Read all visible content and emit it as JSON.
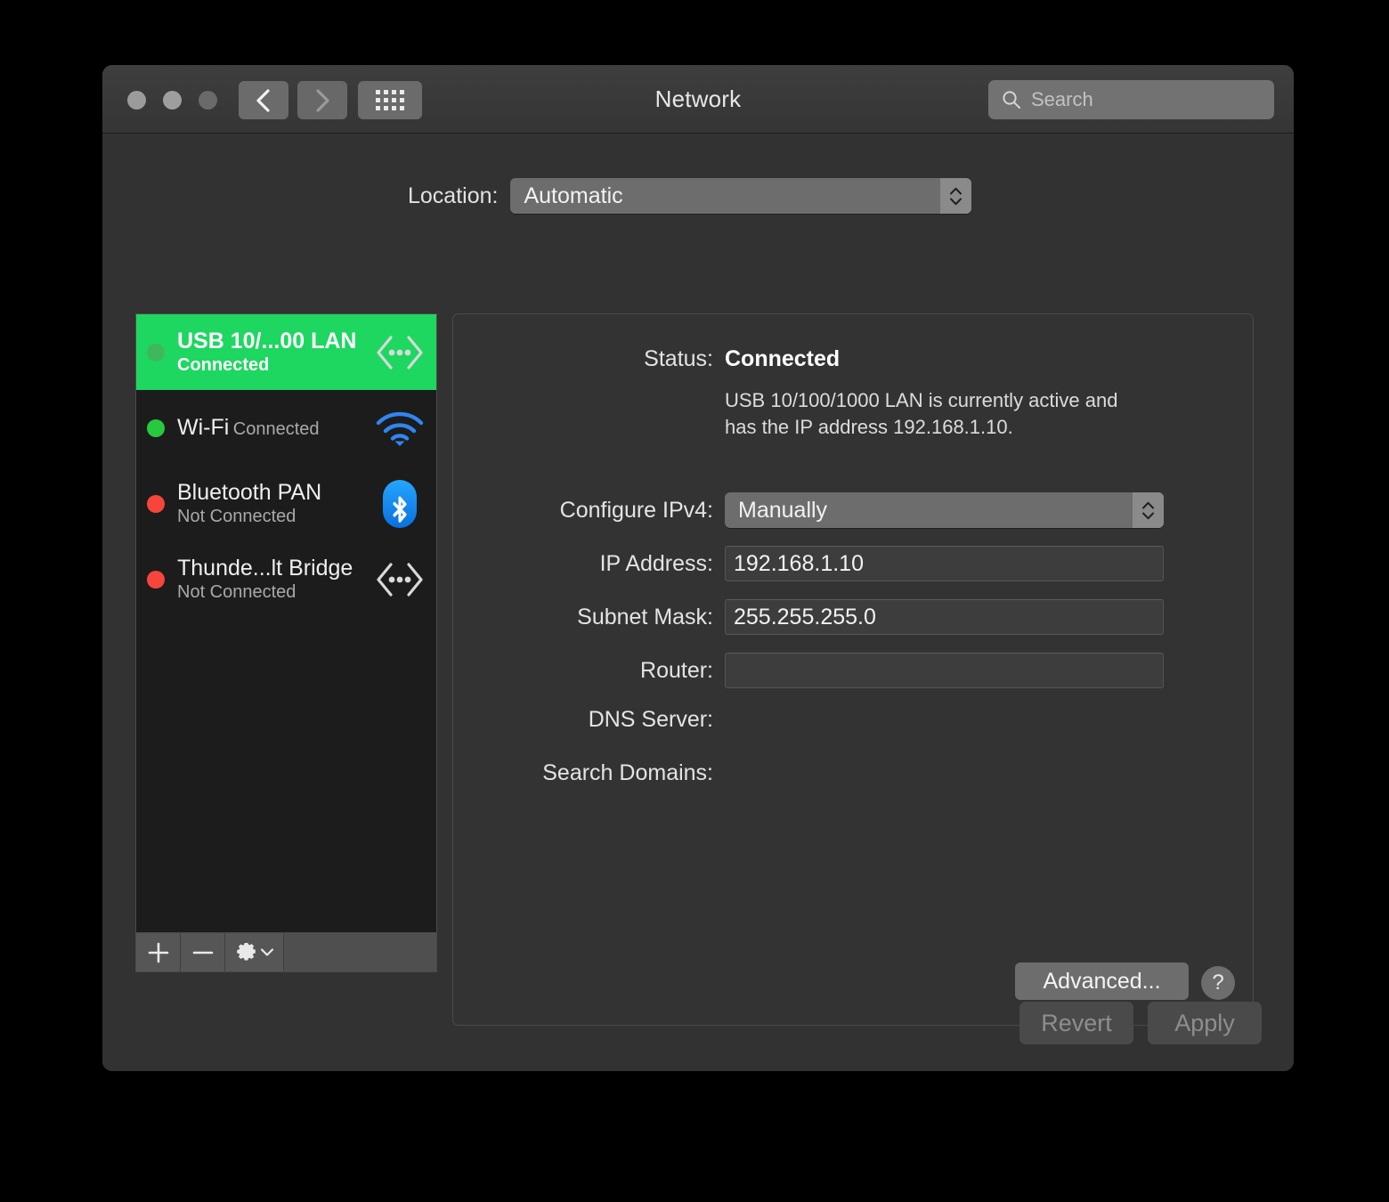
{
  "window": {
    "title": "Network",
    "traffic_lights": [
      "close-button",
      "minimize-button",
      "zoom-button"
    ],
    "nav": {
      "back": "back-button",
      "forward": "forward-button",
      "grid": "show-all-button"
    }
  },
  "search": {
    "placeholder": "Search",
    "value": "",
    "icon": "search-icon"
  },
  "location": {
    "label": "Location:",
    "value": "Automatic"
  },
  "interfaces": [
    {
      "name": "USB 10/...00 LAN",
      "state": "Connected",
      "dot": "green",
      "icon": "ethernet-icon",
      "selected": true
    },
    {
      "name": "Wi-Fi",
      "state": "Connected",
      "dot": "green",
      "icon": "wifi-icon",
      "selected": false
    },
    {
      "name": "Bluetooth PAN",
      "state": "Not Connected",
      "dot": "red",
      "icon": "bluetooth-icon",
      "selected": false
    },
    {
      "name": "Thunde...lt Bridge",
      "state": "Not Connected",
      "dot": "red",
      "icon": "ethernet-icon",
      "selected": false
    }
  ],
  "sidebar_toolbar": {
    "add": "+",
    "remove": "−",
    "gear": "gear-icon"
  },
  "detail": {
    "status_label": "Status:",
    "status_value": "Connected",
    "status_description": "USB 10/100/1000 LAN is currently active and has the IP address 192.168.1.10.",
    "configure_ipv4_label": "Configure IPv4:",
    "configure_ipv4_value": "Manually",
    "ip_address_label": "IP Address:",
    "ip_address_value": "192.168.1.10",
    "subnet_mask_label": "Subnet Mask:",
    "subnet_mask_value": "255.255.255.0",
    "router_label": "Router:",
    "router_value": "",
    "dns_server_label": "DNS Server:",
    "dns_server_value": "",
    "search_domains_label": "Search Domains:",
    "search_domains_value": "",
    "advanced_label": "Advanced...",
    "help_label": "?"
  },
  "footer": {
    "revert_label": "Revert",
    "apply_label": "Apply"
  },
  "colors": {
    "selection_green": "#1ed760",
    "status_green": "#27c93f",
    "status_red": "#f8453c",
    "bluetooth_blue": "#1a8cf0",
    "wifi_blue": "#2a7df5",
    "window_bg": "#323232",
    "sidebar_bg": "#1c1c1c"
  }
}
